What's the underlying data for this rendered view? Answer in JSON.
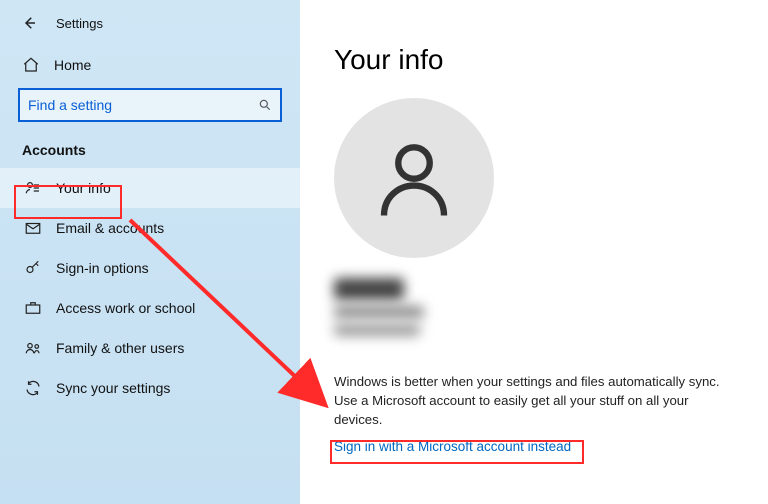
{
  "header": {
    "title": "Settings"
  },
  "sidebar": {
    "home_label": "Home",
    "search_placeholder": "Find a setting",
    "section_label": "Accounts",
    "items": [
      {
        "label": "Your info"
      },
      {
        "label": "Email & accounts"
      },
      {
        "label": "Sign-in options"
      },
      {
        "label": "Access work or school"
      },
      {
        "label": "Family & other users"
      },
      {
        "label": "Sync your settings"
      }
    ]
  },
  "main": {
    "title": "Your info",
    "description": "Windows is better when your settings and files automatically sync. Use a Microsoft account to easily get all your stuff on all your devices.",
    "signin_link": "Sign in with a Microsoft account instead"
  },
  "colors": {
    "highlight": "#ff2a2a",
    "link": "#0067c0",
    "search_border": "#0a5fd6"
  }
}
